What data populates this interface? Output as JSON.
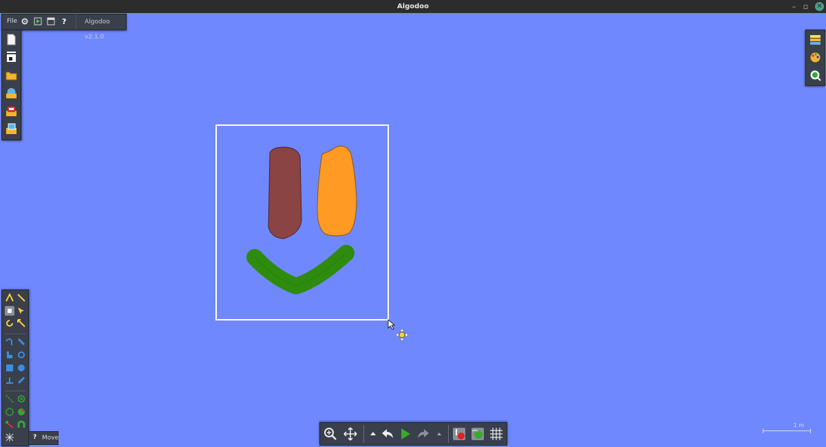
{
  "window": {
    "title": "Algodoo"
  },
  "top_toolbar": {
    "file_label": "File",
    "version": "Algodoo v2.1.0",
    "icons": [
      "gear-icon",
      "play-window-icon",
      "window-icon",
      "help-icon"
    ]
  },
  "left_toolbar": {
    "icons": [
      "new-scene-icon",
      "scene-properties-icon",
      "open-folder-icon",
      "algobox-icon",
      "lessons-icon",
      "save-folder-icon"
    ]
  },
  "right_toolbar": {
    "icons": [
      "layers-icon",
      "palette-icon",
      "zoom-to-fit-icon"
    ]
  },
  "toolbox": {
    "tools": [
      "sketch-tool",
      "cut-tool",
      "move-tool",
      "drag-tool",
      "rotate-tool",
      "scale-tool",
      "rope-tool",
      "spring-tool",
      "fixate-tool",
      "gear-tool",
      "box-tool",
      "circle-tool",
      "plane-tool",
      "chain-tool",
      "tracer-tool",
      "hinge-tool",
      "thruster-tool",
      "laser-tool",
      "spring-axle-tool",
      "magnet-tool",
      "brush-tool"
    ],
    "current_mode": "Move",
    "help_label": "?"
  },
  "bottom_toolbar": {
    "icons": [
      "zoom-icon",
      "pan-icon",
      "up-arrow-icon",
      "undo-icon",
      "play-icon",
      "redo-icon",
      "dropdown-arrow-icon",
      "gravity-icon",
      "air-icon",
      "grid-icon"
    ]
  },
  "scale": {
    "label": "1 m"
  },
  "colors": {
    "background": "#7088fd",
    "maroon_shape": "#8b4444",
    "orange_shape": "#ff9a23",
    "green_shape": "#2e8b0d",
    "panel": "#3a3f4c"
  }
}
